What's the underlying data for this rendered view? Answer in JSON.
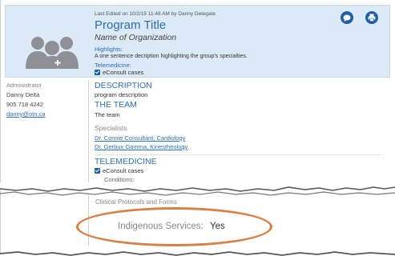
{
  "header": {
    "last_edited": "Last Edited on 10/2/15 11:48 AM by Danny Delegate",
    "program_title": "Program Title",
    "org_name": "Name of Organization",
    "highlights_label": "Highlights:",
    "highlights_text": "A one sentence decription highlighting the group's specialties.",
    "telemedicine_label": "Telemedicine:",
    "telemedicine_item": "eConsult cases",
    "buttons": {
      "chat": "chat-bubble-icon",
      "print": "print-icon"
    }
  },
  "contact": {
    "role": "Administrator",
    "name": "Danny Delta",
    "phone": "905 718 4242",
    "email": "danny@otn.ca"
  },
  "main": {
    "description_heading": "DESCRIPTION",
    "description_text": "program description",
    "team_heading": "THE TEAM",
    "team_text": "The team",
    "specialists_heading": "Specialists",
    "specialists": [
      "Dr. Connie Consultant, Cardiology",
      "Dr. Gerbux Gamma, Kinestheology"
    ],
    "telemedicine_heading": "TELEMEDICINE",
    "telemedicine_item": "eConsult cases",
    "conditions_label": "Conditions:"
  },
  "lower": {
    "clinical_protocols": "Clinical Protocols and Forms",
    "indigenous_label": "Indigenous Services:",
    "indigenous_value": "Yes"
  },
  "colors": {
    "accent": "#2a6fb8",
    "button": "#1f5fa8",
    "header_bg": "#dce9f6",
    "highlight_ellipse": "#d97f45"
  }
}
